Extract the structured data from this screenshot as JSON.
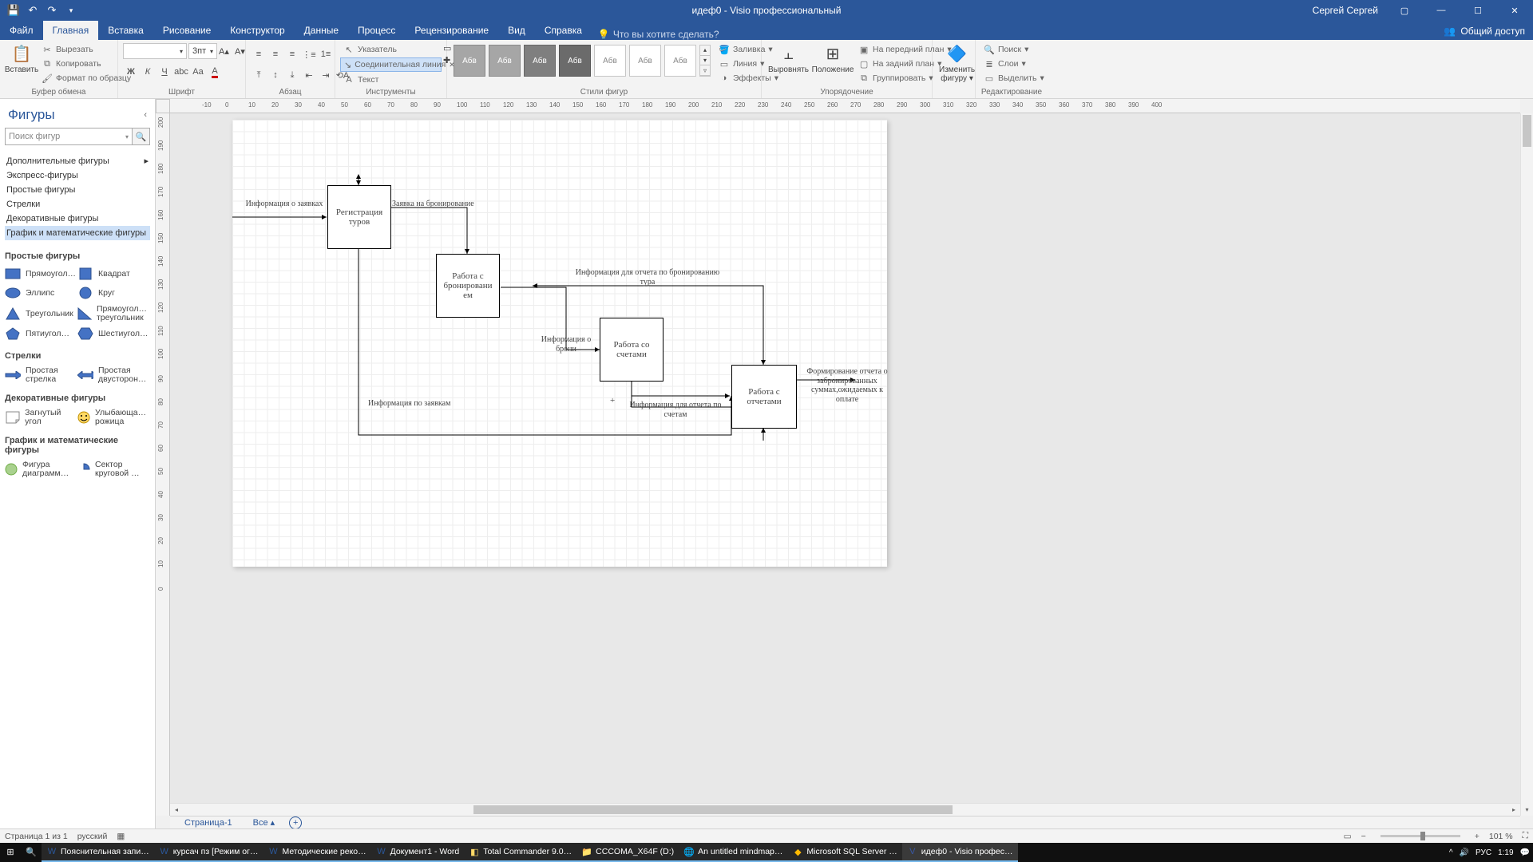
{
  "title": "идеф0  -  Visio профессиональный",
  "user": "Сергей Сергей",
  "tabs": {
    "file": "Файл",
    "home": "Главная",
    "insert": "Вставка",
    "draw": "Рисование",
    "design": "Конструктор",
    "data": "Данные",
    "process": "Процесс",
    "review": "Рецензирование",
    "view": "Вид",
    "help": "Справка",
    "tellme": "Что вы хотите сделать?",
    "share": "Общий доступ"
  },
  "ribbon": {
    "clipboard": {
      "paste": "Вставить",
      "cut": "Вырезать",
      "copy": "Копировать",
      "fmt": "Формат по образцу",
      "label": "Буфер обмена"
    },
    "font": {
      "size": "3пт",
      "label": "Шрифт"
    },
    "paragraph": {
      "label": "Абзац"
    },
    "tools": {
      "pointer": "Указатель",
      "connector": "Соединительная линия",
      "text": "Текст",
      "label": "Инструменты"
    },
    "styles": {
      "sample": "Абв",
      "label": "Стили фигур",
      "fill": "Заливка",
      "line": "Линия",
      "effects": "Эффекты"
    },
    "arrange": {
      "align": "Выровнять",
      "position": "Положение",
      "front": "На передний план",
      "back": "На задний план",
      "group": "Группировать",
      "label": "Упорядочение"
    },
    "editshape": {
      "change": "Изменить фигуру ▾",
      "label": ""
    },
    "editing": {
      "find": "Поиск",
      "layers": "Слои",
      "select": "Выделить",
      "label": "Редактирование"
    }
  },
  "shapes": {
    "title": "Фигуры",
    "search": "Поиск фигур",
    "more": "Дополнительные фигуры",
    "stencils": [
      "Экспресс-фигуры",
      "Простые фигуры",
      "Стрелки",
      "Декоративные фигуры",
      "График и математические фигуры"
    ],
    "s1": {
      "hdr": "Простые фигуры",
      "items": [
        "Прямоугол…",
        "Квадрат",
        "Эллипс",
        "Круг",
        "Треугольник",
        "Прямоугол… треугольник",
        "Пятиугол…",
        "Шестиугол…"
      ]
    },
    "s2": {
      "hdr": "Стрелки",
      "items": [
        "Простая стрелка",
        "Простая двусторон…"
      ]
    },
    "s3": {
      "hdr": "Декоративные фигуры",
      "items": [
        "Загнутый угол",
        "Улыбающа… рожица"
      ]
    },
    "s4": {
      "hdr": "График и математические фигуры",
      "items": [
        "Фигура диаграмм…",
        "Сектор круговой …"
      ]
    }
  },
  "diagram": {
    "b1": "Регистрация туров",
    "b2": "Работа с бронировани ем",
    "b3": "Работа со счетами",
    "b4": "Работа с отчетами",
    "l_in": "Информация о заявках",
    "l_req": "Заявка на бронирование",
    "l_rep": "Информация для отчета по бронированию тура",
    "l_book": "Информация о брони",
    "l_bottom": "Информация по заявкам",
    "l_inv": "Информация для отчета по счетам",
    "l_out": "Формирование отчета о забронированных суммах,ожидаемых к оплате"
  },
  "sheet": {
    "page": "Страница-1",
    "all": "Все"
  },
  "status": {
    "page": "Страница 1 из 1",
    "lang": "русский",
    "zoom": "101 %"
  },
  "taskbar": {
    "items": [
      "Пояснительная запи…",
      "курсач пз [Режим ог…",
      "Методические реко…",
      "Документ1 - Word",
      "Total Commander 9.0…",
      "CCCOMA_X64F (D:)",
      "An untitled mindmap…",
      "Microsoft SQL Server …",
      "идеф0 - Visio профес…"
    ],
    "lang": "РУС",
    "time": "1:19"
  }
}
